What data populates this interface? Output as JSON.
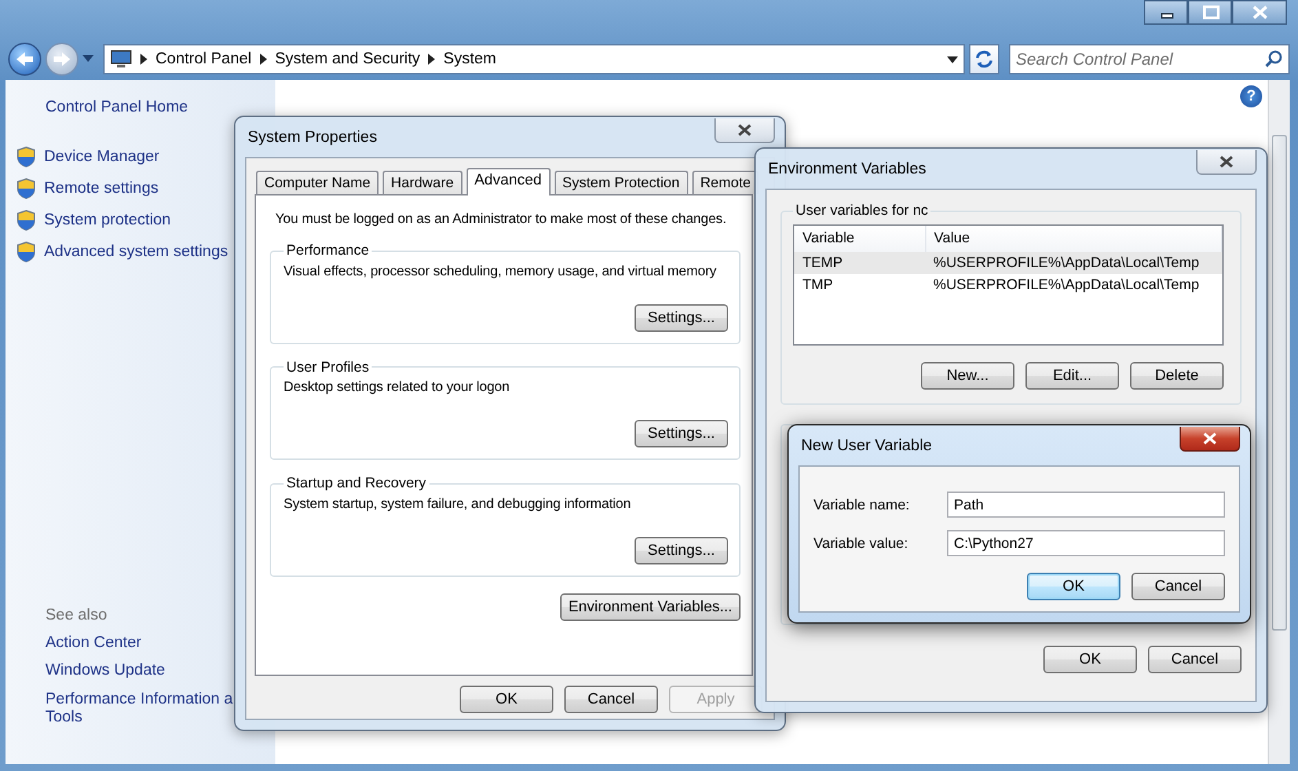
{
  "explorer": {
    "breadcrumb": [
      "Control Panel",
      "System and Security",
      "System"
    ],
    "search": {
      "placeholder": "Search Control Panel"
    },
    "help": "?",
    "sidebar": {
      "home": "Control Panel Home",
      "tasks": [
        "Device Manager",
        "Remote settings",
        "System protection",
        "Advanced system settings"
      ],
      "see_also": {
        "heading": "See also",
        "links": [
          {
            "lines": [
              "Action Center"
            ]
          },
          {
            "lines": [
              "Windows Update"
            ]
          },
          {
            "lines": [
              "Performance Information a",
              "Tools"
            ]
          }
        ]
      }
    }
  },
  "system_properties": {
    "title": "System Properties",
    "tabs": [
      {
        "label": "Computer Name",
        "selected": false
      },
      {
        "label": "Hardware",
        "selected": false
      },
      {
        "label": "Advanced",
        "selected": true
      },
      {
        "label": "System Protection",
        "selected": false
      },
      {
        "label": "Remote",
        "selected": false
      }
    ],
    "note": "You must be logged on as an Administrator to make most of these changes.",
    "groups": [
      {
        "title": "Performance",
        "description": "Visual effects, processor scheduling, memory usage, and virtual memory",
        "button": "Settings..."
      },
      {
        "title": "User Profiles",
        "description": "Desktop settings related to your logon",
        "button": "Settings..."
      },
      {
        "title": "Startup and Recovery",
        "description": "System startup, system failure, and debugging information",
        "button": "Settings..."
      }
    ],
    "env_button": "Environment Variables...",
    "buttons": [
      {
        "label": "OK",
        "disabled": false
      },
      {
        "label": "Cancel",
        "disabled": false
      },
      {
        "label": "Apply",
        "disabled": true
      }
    ]
  },
  "environment_variables": {
    "title": "Environment Variables",
    "user_group": {
      "title": "User variables for nc",
      "columns": [
        "Variable",
        "Value"
      ],
      "rows": [
        {
          "variable": "TEMP",
          "value": "%USERPROFILE%\\AppData\\Local\\Temp",
          "selected": true
        },
        {
          "variable": "TMP",
          "value": "%USERPROFILE%\\AppData\\Local\\Temp",
          "selected": false
        }
      ],
      "buttons": [
        "New...",
        "Edit...",
        "Delete"
      ]
    },
    "buttons": [
      "OK",
      "Cancel"
    ]
  },
  "new_user_variable": {
    "title": "New User Variable",
    "fields": [
      {
        "label": "Variable name:",
        "value": "Path"
      },
      {
        "label": "Variable value:",
        "value": "C:\\Python27"
      }
    ],
    "buttons": [
      {
        "label": "OK",
        "default": true
      },
      {
        "label": "Cancel",
        "default": false
      }
    ]
  }
}
